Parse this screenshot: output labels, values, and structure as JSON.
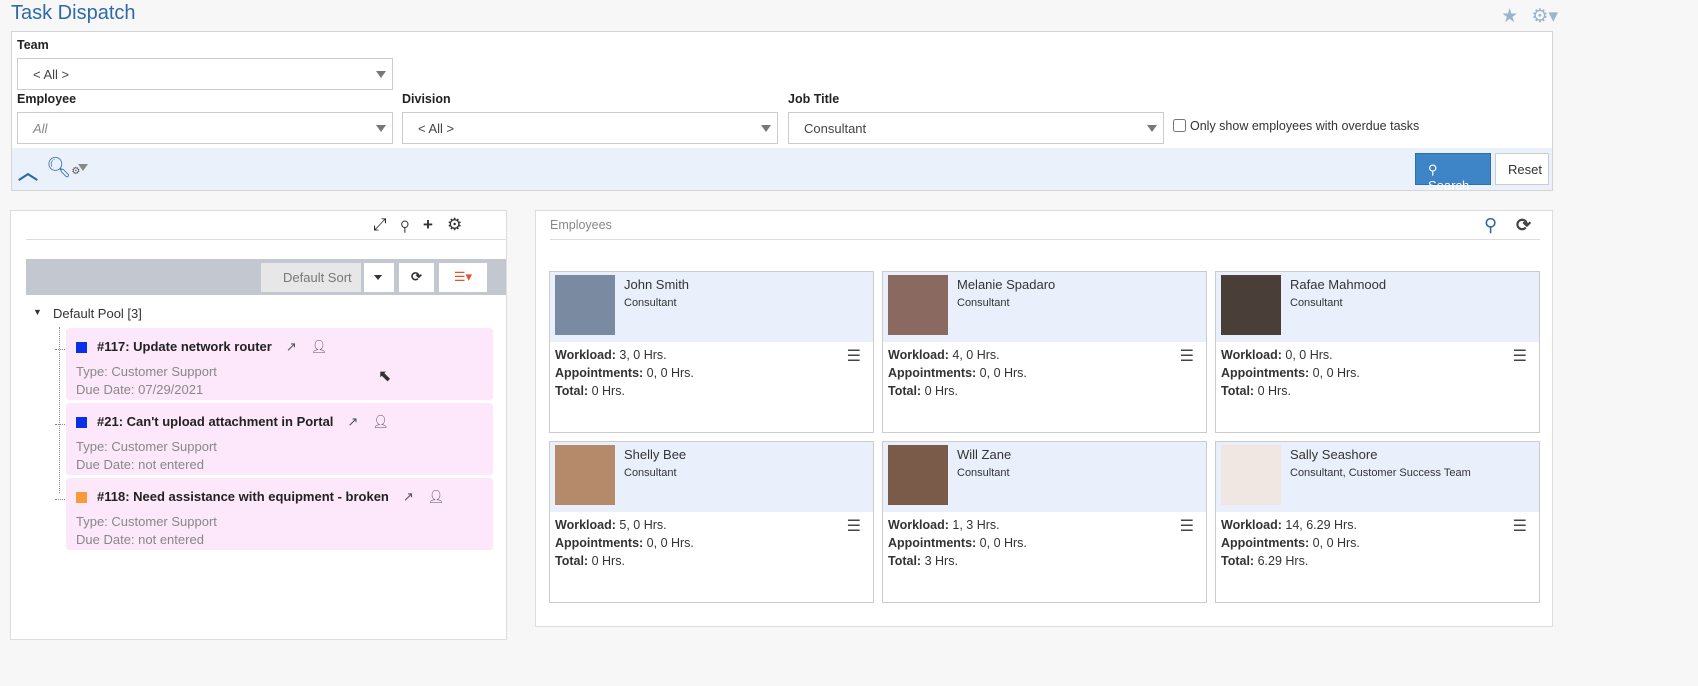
{
  "title": "Task Dispatch",
  "filters": {
    "team_label": "Team",
    "team_value": "< All >",
    "employee_label": "Employee",
    "employee_value": "All",
    "division_label": "Division",
    "division_value": "< All >",
    "job_title_label": "Job Title",
    "job_title_value": "Consultant",
    "overdue_label": "Only show employees with overdue tasks",
    "overdue_checked": false,
    "search": "Search",
    "reset": "Reset"
  },
  "tasks_panel": {
    "sort_label": "Default Sort",
    "pool_label": "Default Pool [3]",
    "tasks": [
      {
        "title": "#117: Update network router",
        "type": "Type: Customer Support",
        "due": "Due Date: 07/29/2021",
        "color": "#0a2fe8"
      },
      {
        "title": "#21: Can't upload attachment in Portal",
        "type": "Type: Customer Support",
        "due": "Due Date: not entered",
        "color": "#0a2fe8"
      },
      {
        "title": "#118: Need assistance with equipment - broken",
        "type": "Type: Customer Support",
        "due": "Due Date: not entered",
        "color": "#f79a3a"
      }
    ]
  },
  "employees_panel": {
    "title": "Employees",
    "labels": {
      "workload": "Workload:",
      "appointments": "Appointments:",
      "total": "Total:"
    },
    "employees": [
      {
        "name": "John Smith",
        "job": "Consultant",
        "workload": "3, 0 Hrs.",
        "appointments": "0, 0 Hrs.",
        "total": "0 Hrs.",
        "avatar_color": "#7a8aa0"
      },
      {
        "name": "Melanie Spadaro",
        "job": "Consultant",
        "workload": "4, 0 Hrs.",
        "appointments": "0, 0 Hrs.",
        "total": "0 Hrs.",
        "avatar_color": "#8a6a60"
      },
      {
        "name": "Rafae Mahmood",
        "job": "Consultant",
        "workload": "0, 0 Hrs.",
        "appointments": "0, 0 Hrs.",
        "total": "0 Hrs.",
        "avatar_color": "#4a3f38"
      },
      {
        "name": "Shelly Bee",
        "job": "Consultant",
        "workload": "5, 0 Hrs.",
        "appointments": "0, 0 Hrs.",
        "total": "0 Hrs.",
        "avatar_color": "#b58a6a"
      },
      {
        "name": "Will Zane",
        "job": "Consultant",
        "workload": "1, 3 Hrs.",
        "appointments": "0, 0 Hrs.",
        "total": "3 Hrs.",
        "avatar_color": "#7a5a48"
      },
      {
        "name": "Sally Seashore",
        "job": "Consultant, Customer Success Team",
        "workload": "14, 6.29 Hrs.",
        "appointments": "0, 0 Hrs.",
        "total": "6.29 Hrs.",
        "avatar_color": "#f0e6e2"
      }
    ]
  }
}
